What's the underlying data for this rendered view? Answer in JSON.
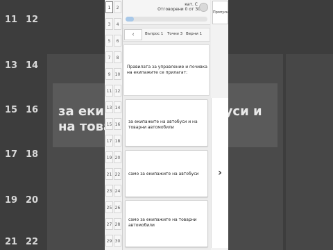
{
  "background": {
    "grid_numbers": [
      "11",
      "12",
      "13",
      "14",
      "15",
      "16",
      "17",
      "18",
      "19",
      "20",
      "21",
      "22"
    ],
    "question_text": "за екипажите на автобуси и на товарни автомобили"
  },
  "header": {
    "category": "кат. С",
    "answered": "Отговорени 0 от 30",
    "progress_fraction": 0.1
  },
  "nav": {
    "question": "Въпрос 1",
    "points": "Точки 3",
    "correct": "Верни 1"
  },
  "question": {
    "text": "Правилата за управление и почивка на екипажите се прилагат:"
  },
  "answers": [
    {
      "text": "за екипажите на автобуси и на товарни автомобили"
    },
    {
      "text": "само за екипажите на автобуси"
    },
    {
      "text": "само за екипажите на товарни автомобили"
    }
  ],
  "question_numbers": [
    [
      "1",
      "2"
    ],
    [
      "3",
      "4"
    ],
    [
      "5",
      "6"
    ],
    [
      "7",
      "8"
    ],
    [
      "9",
      "10"
    ],
    [
      "11",
      "12"
    ],
    [
      "13",
      "14"
    ],
    [
      "15",
      "16"
    ],
    [
      "17",
      "18"
    ],
    [
      "19",
      "20"
    ],
    [
      "21",
      "22"
    ],
    [
      "23",
      "24"
    ],
    [
      "25",
      "26"
    ],
    [
      "27",
      "28"
    ],
    [
      "29",
      "30"
    ]
  ],
  "side": {
    "skip_label": "Пропусни",
    "next_glyph": "›"
  }
}
